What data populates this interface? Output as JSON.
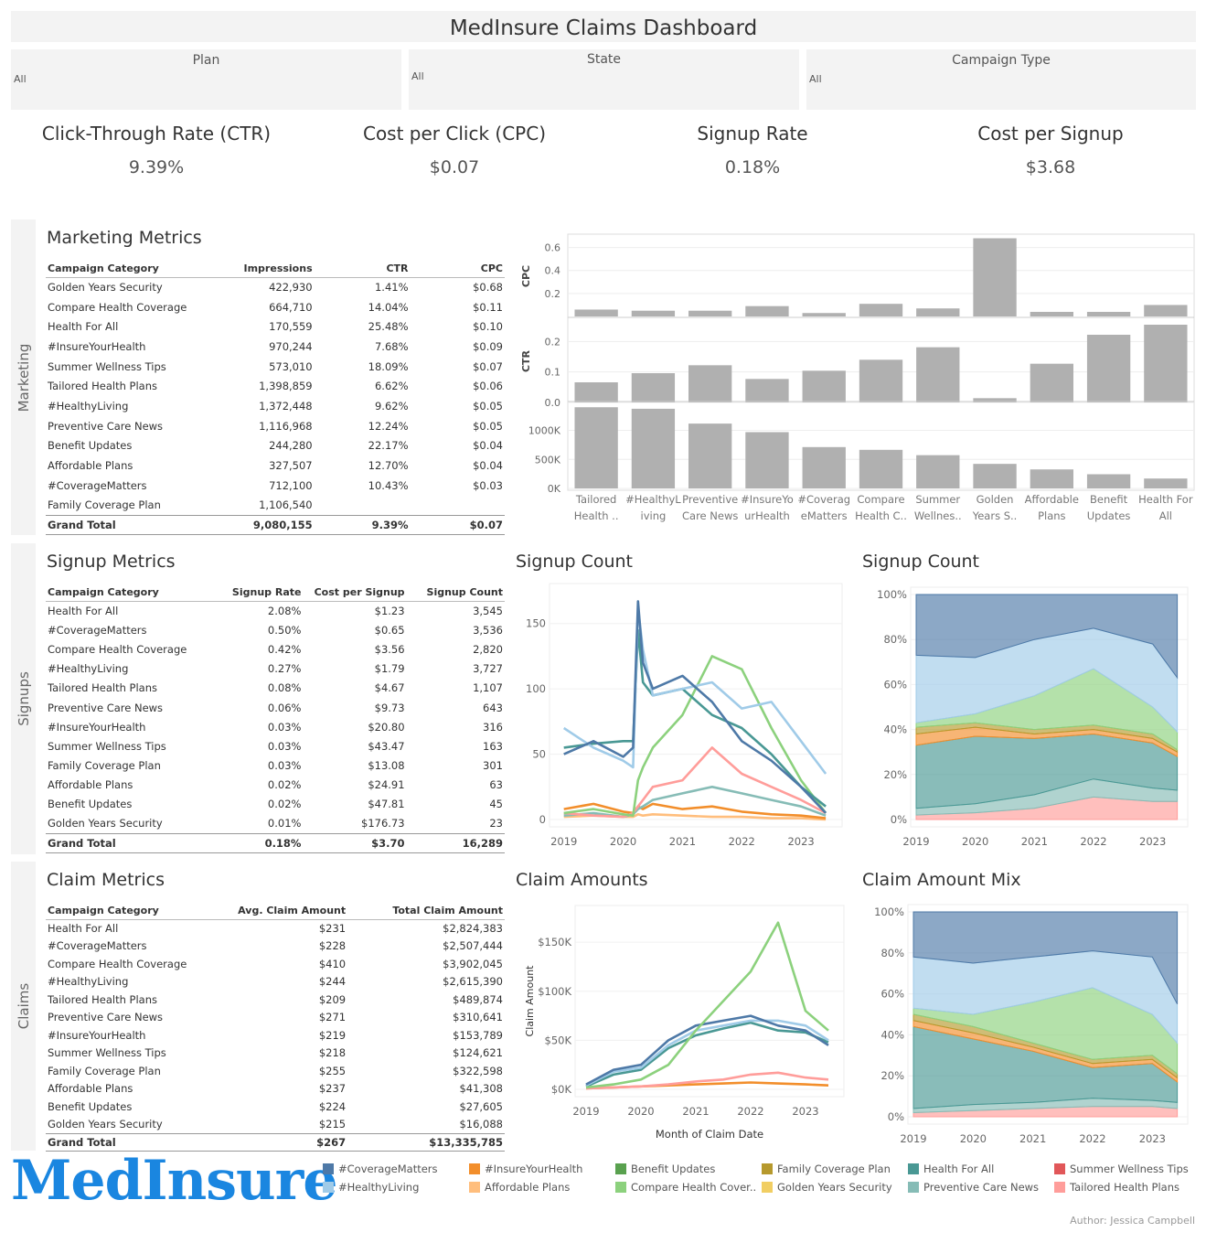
{
  "header": {
    "title": "MedInsure Claims Dashboard"
  },
  "filters": [
    {
      "label": "Plan",
      "value": "All"
    },
    {
      "label": "State",
      "value": "All"
    },
    {
      "label": "Campaign Type",
      "value": "All"
    }
  ],
  "kpis": [
    {
      "label": "Click-Through Rate (CTR)",
      "value": "9.39%"
    },
    {
      "label": "Cost per Click (CPC)",
      "value": "$0.07"
    },
    {
      "label": "Signup Rate",
      "value": "0.18%"
    },
    {
      "label": "Cost per Signup",
      "value": "$3.68"
    }
  ],
  "sections": {
    "marketing": "Marketing",
    "signups": "Signups",
    "claims": "Claims"
  },
  "marketing": {
    "title": "Marketing Metrics",
    "headers": [
      "Campaign Category",
      "Impressions",
      "CTR",
      "CPC"
    ],
    "rows": [
      [
        "Golden Years Security",
        "422,930",
        "1.41%",
        "$0.68"
      ],
      [
        "Compare Health Coverage",
        "664,710",
        "14.04%",
        "$0.11"
      ],
      [
        "Health For All",
        "170,559",
        "25.48%",
        "$0.10"
      ],
      [
        "#InsureYourHealth",
        "970,244",
        "7.68%",
        "$0.09"
      ],
      [
        "Summer Wellness Tips",
        "573,010",
        "18.09%",
        "$0.07"
      ],
      [
        "Tailored Health Plans",
        "1,398,859",
        "6.62%",
        "$0.06"
      ],
      [
        "#HealthyLiving",
        "1,372,448",
        "9.62%",
        "$0.05"
      ],
      [
        "Preventive Care News",
        "1,116,968",
        "12.24%",
        "$0.05"
      ],
      [
        "Benefit Updates",
        "244,280",
        "22.17%",
        "$0.04"
      ],
      [
        "Affordable Plans",
        "327,507",
        "12.70%",
        "$0.04"
      ],
      [
        "#CoverageMatters",
        "712,100",
        "10.43%",
        "$0.03"
      ],
      [
        "Family Coverage Plan",
        "1,106,540",
        "",
        ""
      ]
    ],
    "total": [
      "Grand Total",
      "9,080,155",
      "9.39%",
      "$0.07"
    ]
  },
  "signups": {
    "title": "Signup Metrics",
    "headers": [
      "Campaign Category",
      "Signup Rate",
      "Cost per Signup",
      "Signup Count"
    ],
    "rows": [
      [
        "Health For All",
        "2.08%",
        "$1.23",
        "3,545"
      ],
      [
        "#CoverageMatters",
        "0.50%",
        "$0.65",
        "3,536"
      ],
      [
        "Compare Health Coverage",
        "0.42%",
        "$3.56",
        "2,820"
      ],
      [
        "#HealthyLiving",
        "0.27%",
        "$1.79",
        "3,727"
      ],
      [
        "Tailored Health Plans",
        "0.08%",
        "$4.67",
        "1,107"
      ],
      [
        "Preventive Care News",
        "0.06%",
        "$9.73",
        "643"
      ],
      [
        "#InsureYourHealth",
        "0.03%",
        "$20.80",
        "316"
      ],
      [
        "Summer Wellness Tips",
        "0.03%",
        "$43.47",
        "163"
      ],
      [
        "Family Coverage Plan",
        "0.03%",
        "$13.08",
        "301"
      ],
      [
        "Affordable Plans",
        "0.02%",
        "$24.91",
        "63"
      ],
      [
        "Benefit Updates",
        "0.02%",
        "$47.81",
        "45"
      ],
      [
        "Golden Years Security",
        "0.01%",
        "$176.73",
        "23"
      ]
    ],
    "total": [
      "Grand Total",
      "0.18%",
      "$3.70",
      "16,289"
    ]
  },
  "claims": {
    "title": "Claim Metrics",
    "headers": [
      "Campaign Category",
      "Avg. Claim Amount",
      "Total Claim Amount"
    ],
    "rows": [
      [
        "Health For All",
        "$231",
        "$2,824,383"
      ],
      [
        "#CoverageMatters",
        "$228",
        "$2,507,444"
      ],
      [
        "Compare Health Coverage",
        "$410",
        "$3,902,045"
      ],
      [
        "#HealthyLiving",
        "$244",
        "$2,615,390"
      ],
      [
        "Tailored Health Plans",
        "$209",
        "$489,874"
      ],
      [
        "Preventive Care News",
        "$271",
        "$310,641"
      ],
      [
        "#InsureYourHealth",
        "$219",
        "$153,789"
      ],
      [
        "Summer Wellness Tips",
        "$218",
        "$124,621"
      ],
      [
        "Family Coverage Plan",
        "$255",
        "$322,598"
      ],
      [
        "Affordable Plans",
        "$237",
        "$41,308"
      ],
      [
        "Benefit Updates",
        "$224",
        "$27,605"
      ],
      [
        "Golden Years Security",
        "$215",
        "$16,088"
      ]
    ],
    "total": [
      "Grand Total",
      "$267",
      "$13,335,785"
    ]
  },
  "chart_titles": {
    "signup_count_line": "Signup Count",
    "signup_count_area": "Signup Count",
    "claim_amounts": "Claim Amounts",
    "claim_amount_mix": "Claim Amount Mix"
  },
  "legend": [
    {
      "name": "#CoverageMatters",
      "color": "#4e79a7"
    },
    {
      "name": "#InsureYourHealth",
      "color": "#f28e2b"
    },
    {
      "name": "Benefit Updates",
      "color": "#59a14f"
    },
    {
      "name": "Family Coverage Plan",
      "color": "#b6992d"
    },
    {
      "name": "Health For All",
      "color": "#499894"
    },
    {
      "name": "Summer Wellness Tips",
      "color": "#e15759"
    },
    {
      "name": "#HealthyLiving",
      "color": "#a0cbe8"
    },
    {
      "name": "Affordable Plans",
      "color": "#ffbe7d"
    },
    {
      "name": "Compare Health Cover..",
      "color": "#8cd17d"
    },
    {
      "name": "Golden Years Security",
      "color": "#f1ce63"
    },
    {
      "name": "Preventive Care News",
      "color": "#86bcb6"
    },
    {
      "name": "Tailored Health Plans",
      "color": "#ff9d9a"
    }
  ],
  "logo_text": "MedInsure",
  "author": "Author: Jessica Campbell",
  "chart_data": [
    {
      "type": "bar",
      "categories": [
        "Tailored Health ..",
        "#HealthyLiving",
        "Preventive Care News",
        "#InsureYourHealth",
        "#CoverageMatters",
        "Compare Health C..",
        "Summer Wellnes..",
        "Golden Years S..",
        "Affordable Plans",
        "Benefit Updates",
        "Health For All"
      ],
      "category_labels": [
        [
          "Tailored",
          "Health .."
        ],
        [
          "#HealthyL",
          "iving"
        ],
        [
          "Preventive",
          "Care News"
        ],
        [
          "#InsureYo",
          "urHealth"
        ],
        [
          "#Coverag",
          "eMatters"
        ],
        [
          "Compare",
          "Health C.."
        ],
        [
          "Summer",
          "Wellnes.."
        ],
        [
          "Golden",
          "Years S.."
        ],
        [
          "Affordable",
          "Plans"
        ],
        [
          "Benefit",
          "Updates"
        ],
        [
          "Health For",
          "All"
        ]
      ],
      "series": [
        {
          "name": "CPC",
          "values": [
            0.06,
            0.05,
            0.05,
            0.09,
            0.03,
            0.11,
            0.07,
            0.68,
            0.04,
            0.04,
            0.1
          ],
          "ylim": [
            0,
            0.7
          ],
          "ticks": [
            0.2,
            0.4,
            0.6
          ],
          "tick_labels": [
            "0.2",
            "0.4",
            "0.6"
          ]
        },
        {
          "name": "CTR",
          "values": [
            0.066,
            0.096,
            0.122,
            0.077,
            0.104,
            0.14,
            0.181,
            0.014,
            0.127,
            0.222,
            0.255
          ],
          "ylim": [
            0,
            0.27
          ],
          "ticks": [
            0,
            0.1,
            0.2
          ],
          "tick_labels": [
            "0.0",
            "0.1",
            "0.2"
          ]
        },
        {
          "name": "Impressions",
          "values": [
            1398859,
            1372448,
            1116968,
            970244,
            712100,
            664710,
            573010,
            422930,
            327507,
            244280,
            170559
          ],
          "ylim": [
            0,
            1450000
          ],
          "ticks": [
            0,
            500000,
            1000000
          ],
          "tick_labels": [
            "0K",
            "500K",
            "1000K"
          ]
        }
      ]
    },
    {
      "type": "line",
      "title": "Signup Count",
      "x_ticks": [
        "2019",
        "2020",
        "2021",
        "2022",
        "2023"
      ],
      "y_ticks": [
        0,
        50,
        100,
        150
      ],
      "y_tick_labels": [
        "0",
        "50",
        "100",
        "150"
      ],
      "ylim": [
        0,
        175
      ],
      "x": [
        "2019-01",
        "2019-07",
        "2020-01",
        "2020-03",
        "2020-04",
        "2020-05",
        "2020-07",
        "2021-01",
        "2021-07",
        "2022-01",
        "2022-07",
        "2023-01",
        "2023-06"
      ],
      "series": [
        {
          "name": "#CoverageMatters",
          "values": [
            50,
            60,
            48,
            55,
            167,
            120,
            100,
            110,
            90,
            60,
            45,
            25,
            5
          ]
        },
        {
          "name": "#HealthyLiving",
          "values": [
            70,
            55,
            45,
            40,
            162,
            130,
            95,
            100,
            105,
            85,
            90,
            60,
            35
          ]
        },
        {
          "name": "Health For All",
          "values": [
            55,
            58,
            60,
            60,
            145,
            105,
            95,
            100,
            80,
            70,
            50,
            25,
            10
          ]
        },
        {
          "name": "Compare Health Cover..",
          "values": [
            5,
            8,
            4,
            3,
            30,
            40,
            55,
            80,
            125,
            115,
            70,
            30,
            5
          ]
        },
        {
          "name": "Tailored Health Plans",
          "values": [
            5,
            3,
            2,
            5,
            10,
            15,
            25,
            30,
            55,
            35,
            25,
            15,
            5
          ]
        },
        {
          "name": "Preventive Care News",
          "values": [
            3,
            5,
            2,
            4,
            8,
            10,
            15,
            20,
            25,
            20,
            15,
            10,
            3
          ]
        },
        {
          "name": "#InsureYourHealth",
          "values": [
            8,
            12,
            6,
            5,
            10,
            8,
            12,
            8,
            10,
            6,
            4,
            3,
            1
          ]
        },
        {
          "name": "Affordable Plans",
          "values": [
            2,
            3,
            2,
            2,
            4,
            3,
            4,
            3,
            2,
            2,
            1,
            1,
            0
          ]
        }
      ]
    },
    {
      "type": "area",
      "title": "Signup Count",
      "stacked": "percent",
      "x_ticks": [
        "2019",
        "2020",
        "2021",
        "2022",
        "2023"
      ],
      "y_ticks": [
        "0%",
        "20%",
        "40%",
        "60%",
        "80%",
        "100%"
      ],
      "x": [
        "2019",
        "2020",
        "2021",
        "2022",
        "2023",
        "2023-06"
      ],
      "series": [
        {
          "name": "Tailored Health Plans",
          "values": [
            2,
            3,
            5,
            10,
            8,
            8
          ]
        },
        {
          "name": "Preventive Care News",
          "values": [
            3,
            4,
            6,
            8,
            6,
            5
          ]
        },
        {
          "name": "Health For All",
          "values": [
            28,
            30,
            25,
            20,
            20,
            15
          ]
        },
        {
          "name": "#InsureYourHealth",
          "values": [
            5,
            4,
            2,
            2,
            2,
            2
          ]
        },
        {
          "name": "Family Coverage Plan",
          "values": [
            3,
            2,
            2,
            2,
            2,
            1
          ]
        },
        {
          "name": "Compare Health Cover..",
          "values": [
            2,
            4,
            15,
            25,
            12,
            8
          ]
        },
        {
          "name": "#HealthyLiving",
          "values": [
            30,
            25,
            25,
            18,
            28,
            24
          ]
        },
        {
          "name": "#CoverageMatters",
          "values": [
            27,
            28,
            20,
            15,
            22,
            37
          ]
        }
      ]
    },
    {
      "type": "line",
      "title": "Claim Amounts",
      "xlabel": "Month of Claim Date",
      "ylabel": "Claim Amount",
      "x_ticks": [
        "2019",
        "2020",
        "2021",
        "2022",
        "2023"
      ],
      "y_ticks": [
        0,
        50000,
        100000,
        150000
      ],
      "y_tick_labels": [
        "$0K",
        "$50K",
        "$100K",
        "$150K"
      ],
      "ylim": [
        0,
        180000
      ],
      "x": [
        "2019-01",
        "2019-07",
        "2020-01",
        "2020-07",
        "2021-01",
        "2021-07",
        "2022-01",
        "2022-07",
        "2023-01",
        "2023-06"
      ],
      "series": [
        {
          "name": "Compare Health Cover..",
          "values": [
            2000,
            5000,
            10000,
            25000,
            60000,
            90000,
            120000,
            170000,
            80000,
            60000
          ]
        },
        {
          "name": "#CoverageMatters",
          "values": [
            5000,
            20000,
            25000,
            50000,
            65000,
            70000,
            75000,
            65000,
            60000,
            45000
          ]
        },
        {
          "name": "#HealthyLiving",
          "values": [
            4000,
            18000,
            22000,
            45000,
            60000,
            65000,
            70000,
            70000,
            65000,
            50000
          ]
        },
        {
          "name": "Health For All",
          "values": [
            3000,
            15000,
            20000,
            42000,
            55000,
            62000,
            68000,
            60000,
            58000,
            48000
          ]
        },
        {
          "name": "Tailored Health Plans",
          "values": [
            1000,
            2000,
            3000,
            5000,
            8000,
            10000,
            15000,
            17000,
            12000,
            10000
          ]
        },
        {
          "name": "#InsureYourHealth",
          "values": [
            1000,
            2000,
            3000,
            4000,
            5000,
            6000,
            7000,
            6000,
            5000,
            4000
          ]
        }
      ]
    },
    {
      "type": "area",
      "title": "Claim Amount Mix",
      "stacked": "percent",
      "x_ticks": [
        "2019",
        "2020",
        "2021",
        "2022",
        "2023"
      ],
      "y_ticks": [
        "0%",
        "20%",
        "40%",
        "60%",
        "80%",
        "100%"
      ],
      "x": [
        "2019",
        "2020",
        "2021",
        "2022",
        "2023",
        "2023-06"
      ],
      "series": [
        {
          "name": "Tailored Health Plans",
          "values": [
            2,
            3,
            4,
            5,
            5,
            4
          ]
        },
        {
          "name": "Preventive Care News",
          "values": [
            2,
            3,
            3,
            4,
            3,
            3
          ]
        },
        {
          "name": "Health For All",
          "values": [
            40,
            32,
            25,
            15,
            18,
            10
          ]
        },
        {
          "name": "#InsureYourHealth",
          "values": [
            3,
            3,
            2,
            2,
            2,
            2
          ]
        },
        {
          "name": "Family Coverage Plan",
          "values": [
            3,
            3,
            2,
            2,
            2,
            2
          ]
        },
        {
          "name": "Compare Health Cover..",
          "values": [
            3,
            6,
            20,
            35,
            20,
            15
          ]
        },
        {
          "name": "#HealthyLiving",
          "values": [
            25,
            25,
            22,
            18,
            28,
            19
          ]
        },
        {
          "name": "#CoverageMatters",
          "values": [
            22,
            25,
            22,
            19,
            22,
            45
          ]
        }
      ]
    }
  ]
}
